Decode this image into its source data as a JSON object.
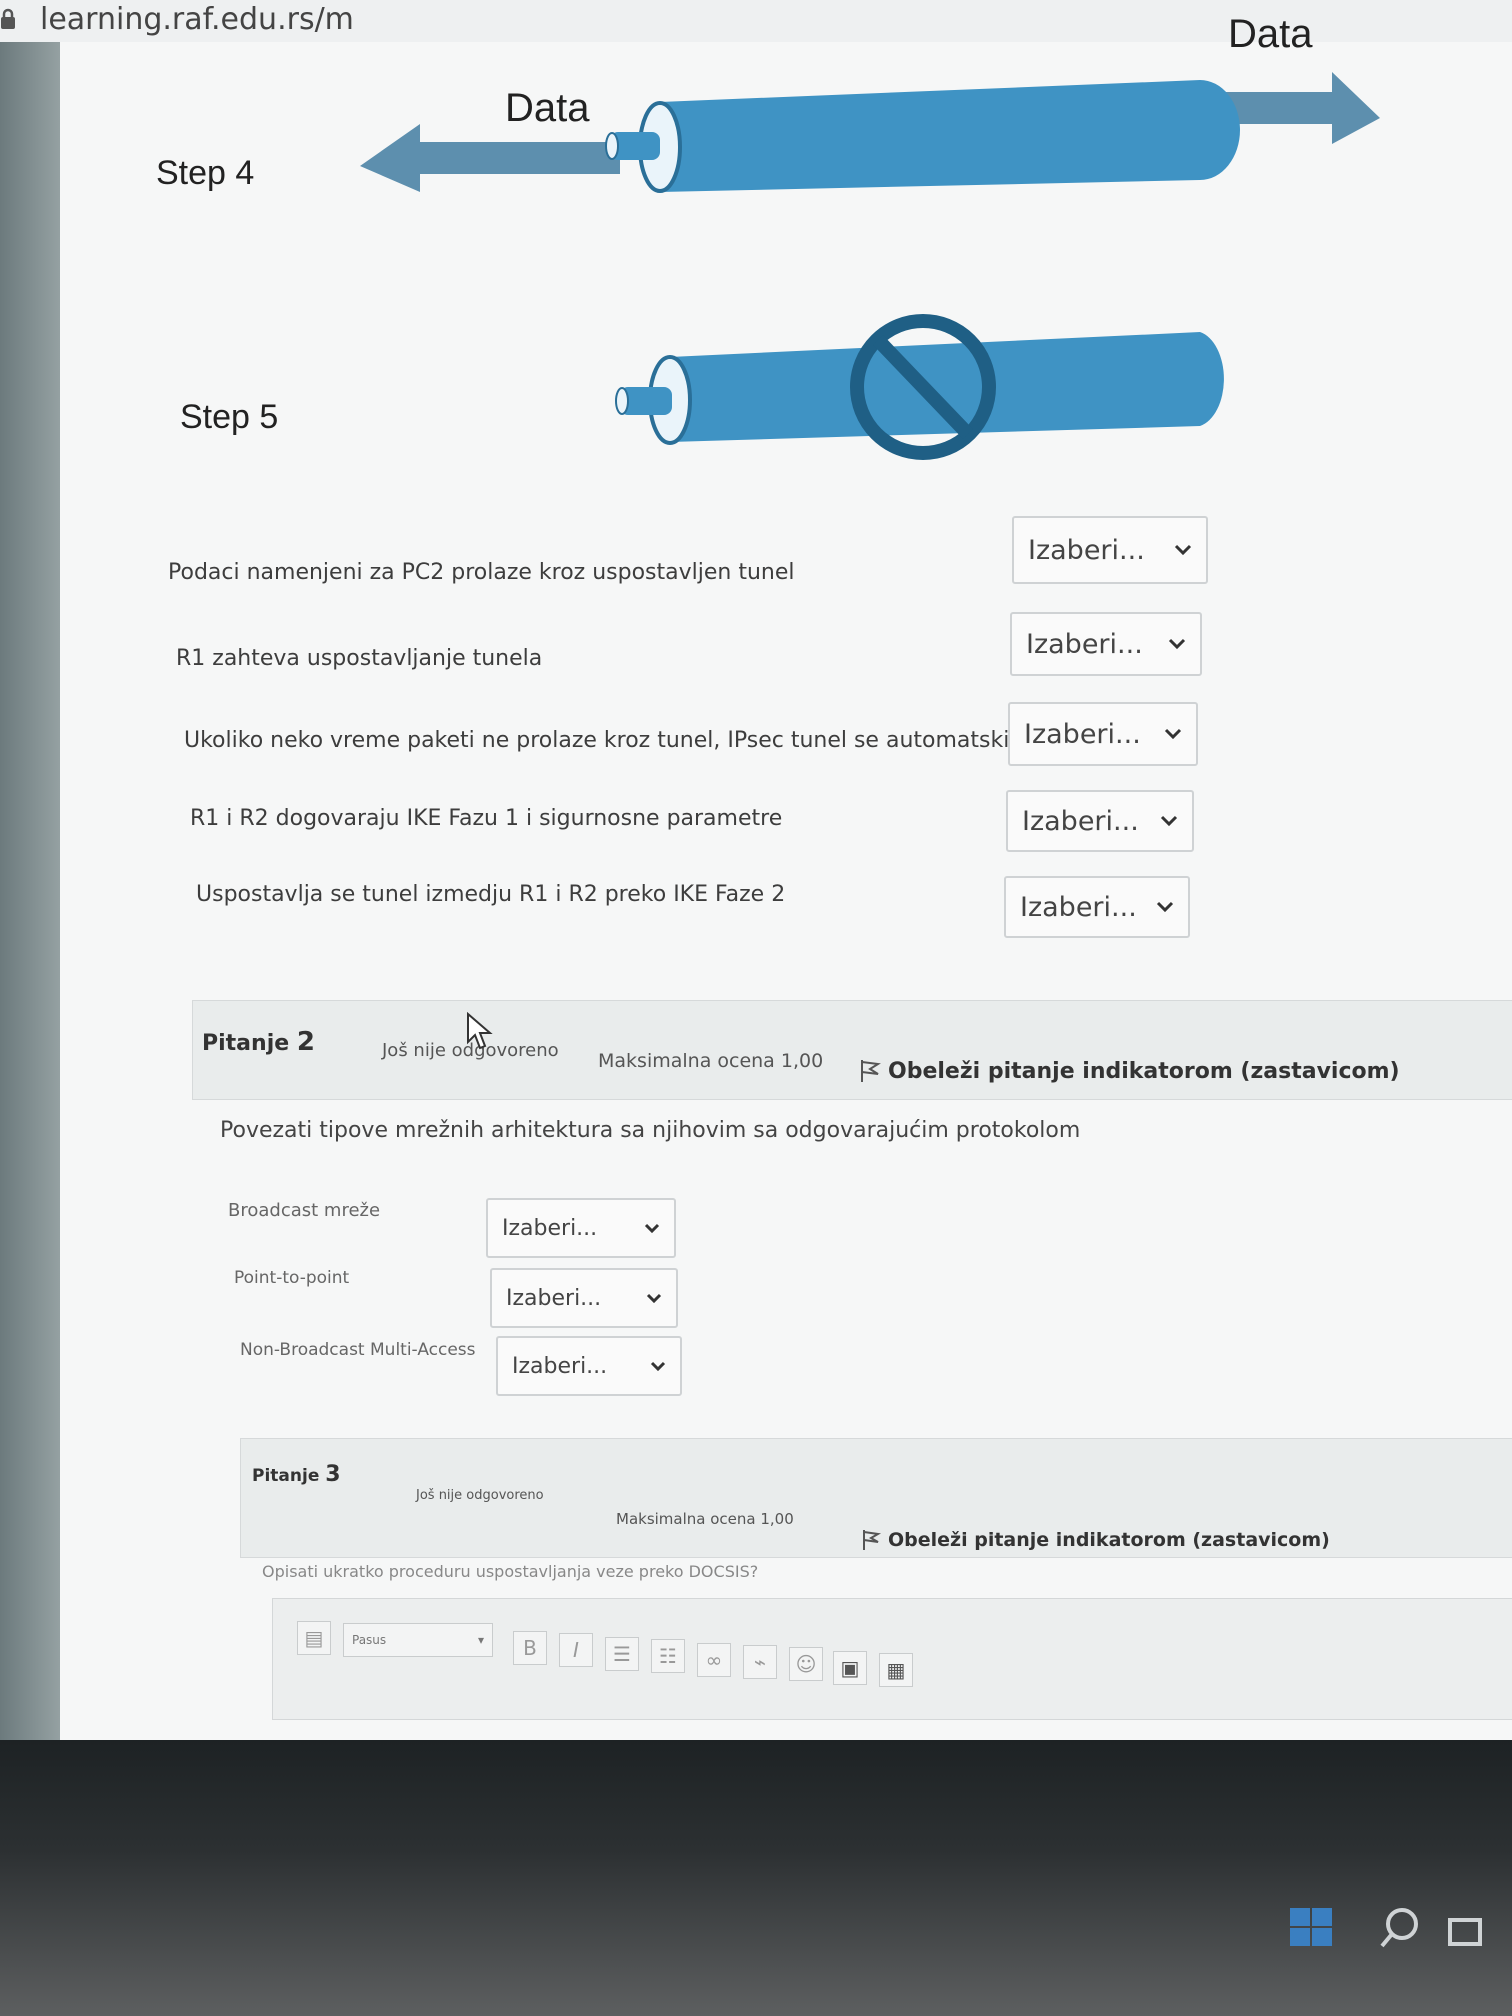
{
  "browser": {
    "url": "learning.raf.edu.rs/m"
  },
  "diagram": {
    "steps": [
      {
        "label": "Step 4",
        "data_left": "Data",
        "data_right": "Data"
      },
      {
        "label": "Step 5"
      }
    ]
  },
  "question1": {
    "rows": [
      {
        "text": "Podaci namenjeni za PC2 prolaze kroz uspostavljen tunel",
        "select": "Izaberi..."
      },
      {
        "text": "R1 zahteva uspostavljanje tunela",
        "select": "Izaberi..."
      },
      {
        "text": "Ukoliko neko vreme paketi ne prolaze kroz tunel, IPsec tunel se automatski gasi",
        "select": "Izaberi..."
      },
      {
        "text": "R1 i R2 dogovaraju IKE Fazu 1 i sigurnosne parametre",
        "select": "Izaberi..."
      },
      {
        "text": "Uspostavlja se tunel izmedju R1 i R2 preko IKE Faze 2",
        "select": "Izaberi..."
      }
    ]
  },
  "question2": {
    "title": "Pitanje",
    "number": "2",
    "status": "Još nije odgovoreno",
    "max_grade": "Maksimalna ocena 1,00",
    "flag": "Obeleži pitanje indikatorom (zastavicom)",
    "prompt": "Povezati tipove mrežnih arhitektura sa njihovim sa odgovarajućim protokolom",
    "rows": [
      {
        "text": "Broadcast mreže",
        "select": "Izaberi..."
      },
      {
        "text": "Point-to-point",
        "select": "Izaberi..."
      },
      {
        "text": "Non-Broadcast Multi-Access",
        "select": "Izaberi..."
      }
    ]
  },
  "question3": {
    "title": "Pitanje",
    "number": "3",
    "status": "Još nije odgovoreno",
    "max_grade": "Maksimalna ocena 1,00",
    "flag": "Obeleži pitanje indikatorom (zastavicom)",
    "prompt": "Opisati ukratko proceduru uspostavljanja veze preko DOCSIS?",
    "editor": {
      "paragraph_select": "Pasus",
      "bold": "B",
      "italic": "I"
    }
  },
  "colors": {
    "tube": "#3f93c4",
    "tube_dark": "#2a6f98",
    "tube_light": "#d4e8f3",
    "arrow": "#5b8fb0"
  }
}
